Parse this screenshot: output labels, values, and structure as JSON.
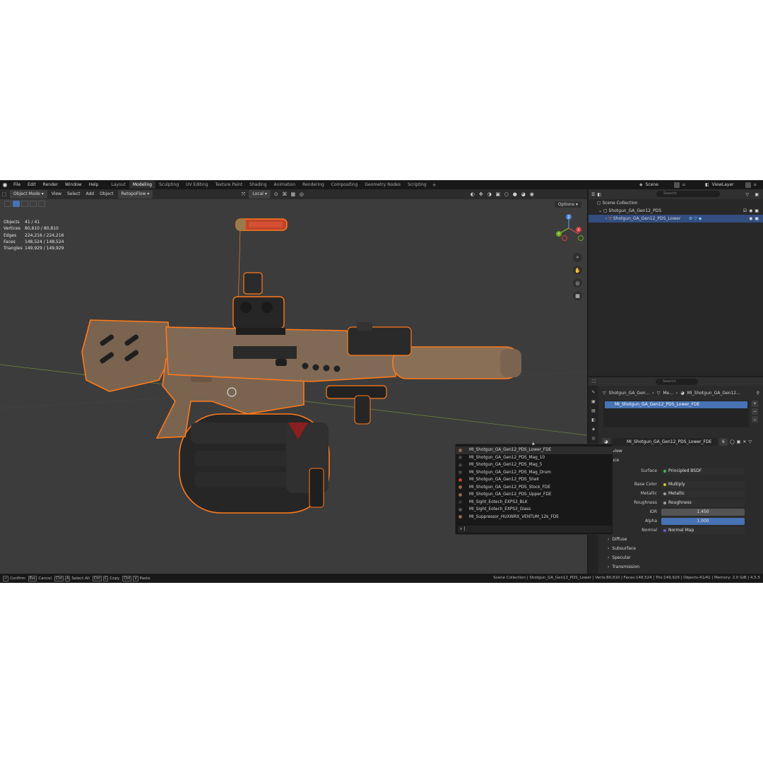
{
  "menu": {
    "items": [
      "File",
      "Edit",
      "Render",
      "Window",
      "Help"
    ],
    "workspaces": [
      "Layout",
      "Modeling",
      "Sculpting",
      "UV Editing",
      "Texture Paint",
      "Shading",
      "Animation",
      "Rendering",
      "Compositing",
      "Geometry Nodes",
      "Scripting"
    ],
    "active_workspace": "Modeling",
    "add": "+",
    "scene": "Scene",
    "view_layer": "ViewLayer"
  },
  "viewport_header": {
    "mode": "Object Mode",
    "view": "View",
    "select": "Select",
    "add": "Add",
    "object": "Object",
    "addon": "RetopoFlow",
    "transform_orientation": "Local",
    "options": "Options"
  },
  "stats": [
    {
      "key": "Objects",
      "value": "41 / 41"
    },
    {
      "key": "Vertices",
      "value": "80,810 / 80,810"
    },
    {
      "key": "Edges",
      "value": "224,216 / 224,216"
    },
    {
      "key": "Faces",
      "value": "148,524 / 148,524"
    },
    {
      "key": "Triangles",
      "value": "149,929 / 149,929"
    }
  ],
  "gizmo": {
    "x": "X",
    "y": "Y",
    "z": "Z"
  },
  "outliner": {
    "search_placeholder": "Search",
    "rows": [
      "Scene Collection",
      "Shotgun_GA_Gen12_PDS",
      "Shotgun_GA_Gen12_PDS_Lower"
    ]
  },
  "properties": {
    "search_placeholder": "Search",
    "breadcrumb": [
      "Shotgun_GA_Gen...",
      "Me...",
      "MI_Shotgun_GA_Gen12..."
    ],
    "slot": "MI_Shotgun_GA_Gen12_PDS_Lower_FDE",
    "material": "MI_Shotgun_GA_Gen12_PDS_Lower_FDE",
    "users": "6",
    "preview_label": "review",
    "surface_label": "rface",
    "rows": [
      {
        "label": "Surface",
        "value": "Principled BSDF",
        "dot": "#3fb950"
      },
      {
        "label": "Base Color",
        "value": "Multiply",
        "dot": "#c7c729"
      },
      {
        "label": "Metallic",
        "value": "Metallic",
        "dot": "#a1a1a1"
      },
      {
        "label": "Roughness",
        "value": "Roughness",
        "dot": "#a1a1a1"
      },
      {
        "label": "IOR",
        "value": "1.450",
        "dot": "#a1a1a1"
      },
      {
        "label": "Alpha",
        "value": "1.000",
        "dot": "#a1a1a1"
      },
      {
        "label": "Normal",
        "value": "Normal Map",
        "dot": "#6363c7"
      }
    ],
    "subpanels": [
      "Diffuse",
      "Subsurface",
      "Specular",
      "Transmission"
    ]
  },
  "dropdown": {
    "items": [
      {
        "name": "MI_Shotgun_GA_Gen12_PDS_Lower_FDE",
        "color": "#8a6a4a"
      },
      {
        "name": "MI_Shotgun_GA_Gen12_PDS_Mag_10",
        "color": "#444444"
      },
      {
        "name": "MI_Shotgun_GA_Gen12_PDS_Mag_5",
        "color": "#444444"
      },
      {
        "name": "MI_Shotgun_GA_Gen12_PDS_Mag_Drum",
        "color": "#444444"
      },
      {
        "name": "MI_Shotgun_GA_Gen12_PDS_Shell",
        "color": "#c0432a"
      },
      {
        "name": "MI_Shotgun_GA_Gen12_PDS_Stock_FDE",
        "color": "#8a6a4a"
      },
      {
        "name": "MI_Shotgun_GA_Gen12_PDS_Upper_FDE",
        "color": "#8a6a4a"
      },
      {
        "name": "MI_Sight_Eotech_EXPS3_BLK",
        "color": "#333333"
      },
      {
        "name": "MI_Sight_Eotech_EXPS3_Glass",
        "color": "#555555"
      },
      {
        "name": "MI_Suppressor_HUXWRX_VENTUM_12k_FDE",
        "color": "#8a6a4a"
      }
    ],
    "search_value": "|"
  },
  "statusbar": {
    "confirm": "Confirm",
    "cancel": "Cancel",
    "select_all": "Select All",
    "copy": "Copy",
    "paste": "Paste",
    "right": "Scene Collection | Shotgun_GA_Gen12_PDS_Lower | Verts:80,810 | Faces:148,524 | Tris:149,929 | Objects:41/41 | Memory: 2.0 GiB | 4.5.5"
  },
  "colors": {
    "accent": "#4772b3",
    "selection_outline": "#ff7a1a",
    "gun_tan": "#7a6450"
  }
}
